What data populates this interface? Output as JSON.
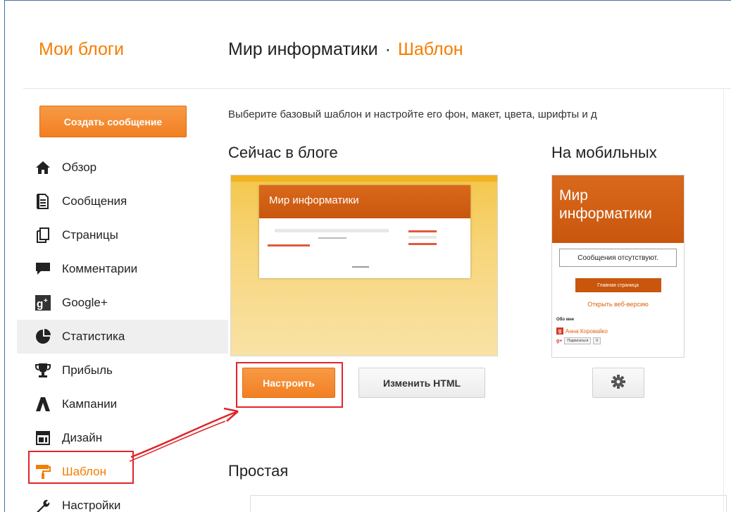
{
  "header": {
    "brand": "Мои блоги",
    "blog_name": "Мир информатики",
    "separator": "·",
    "section": "Шаблон"
  },
  "sidebar": {
    "create_button": "Создать сообщение",
    "items": [
      {
        "label": "Обзор",
        "icon": "home-icon"
      },
      {
        "label": "Сообщения",
        "icon": "posts-icon"
      },
      {
        "label": "Страницы",
        "icon": "pages-icon"
      },
      {
        "label": "Комментарии",
        "icon": "comments-icon"
      },
      {
        "label": "Google+",
        "icon": "google-plus-icon"
      },
      {
        "label": "Статистика",
        "icon": "stats-icon"
      },
      {
        "label": "Прибыль",
        "icon": "trophy-icon"
      },
      {
        "label": "Кампании",
        "icon": "campaigns-icon"
      },
      {
        "label": "Дизайн",
        "icon": "layout-icon"
      },
      {
        "label": "Шаблон",
        "icon": "paint-roller-icon"
      },
      {
        "label": "Настройки",
        "icon": "wrench-icon"
      }
    ]
  },
  "main": {
    "description": "Выберите базовый шаблон и настройте его фон, макет, цвета, шрифты и д",
    "current_heading": "Сейчас в блоге",
    "mobile_heading": "На мобильных",
    "thumb_title": "Мир информатики",
    "mobile_title": "Мир информатики",
    "mobile_no_posts": "Сообщения отсутствуют.",
    "mobile_home": "Главная страница",
    "mobile_web_version": "Открыть веб-версию",
    "mobile_about": "Обо мне",
    "mobile_author": "Анна Коровайко",
    "mobile_subscribe": "Подписаться",
    "mobile_count": "0",
    "customize_button": "Настроить",
    "edit_html_button": "Изменить HTML",
    "simple_heading": "Простая"
  },
  "colors": {
    "accent": "#f57d00",
    "annotation": "#e0252b"
  }
}
